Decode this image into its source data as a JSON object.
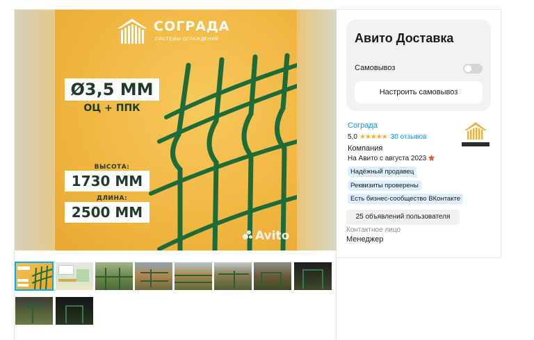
{
  "gallery": {
    "poster": {
      "brand": "СОГРАДА",
      "brand_sub": "СИСТЕМЫ ОГРАЖДЕНИЙ",
      "diameter": "Ø3,5 ММ",
      "coating": "ОЦ + ППК",
      "height_label": "ВЫСОТА:",
      "height_value": "1730 ММ",
      "length_label": "ДЛИНА:",
      "length_value": "2500 ММ",
      "watermark": "Avito"
    },
    "thumbnail_count": 10,
    "active_thumbnail": 1
  },
  "delivery": {
    "title": "Авито Доставка",
    "pickup_label": "Самовывоз",
    "pickup_enabled": false,
    "setup_button": "Настроить самовывоз"
  },
  "seller": {
    "name": "Соградa",
    "rating": "5,0",
    "stars": "★★★★★",
    "reviews": "30 отзывов",
    "type": "Компания",
    "since": "На Авито с августа 2023",
    "badges": [
      "Надёжный продавец",
      "Реквизиты проверены",
      "Есть бизнес-сообщество ВКонтакте"
    ],
    "ads_button": "25 объявлений пользователя",
    "contact_label": "Контактное лицо",
    "contact_value": "Менеджер"
  },
  "colors": {
    "accent": "#0099f7",
    "fence_green": "#1e6b3a",
    "poster_yellow": "#f0b540",
    "badge_bg": "#dbeffd"
  }
}
